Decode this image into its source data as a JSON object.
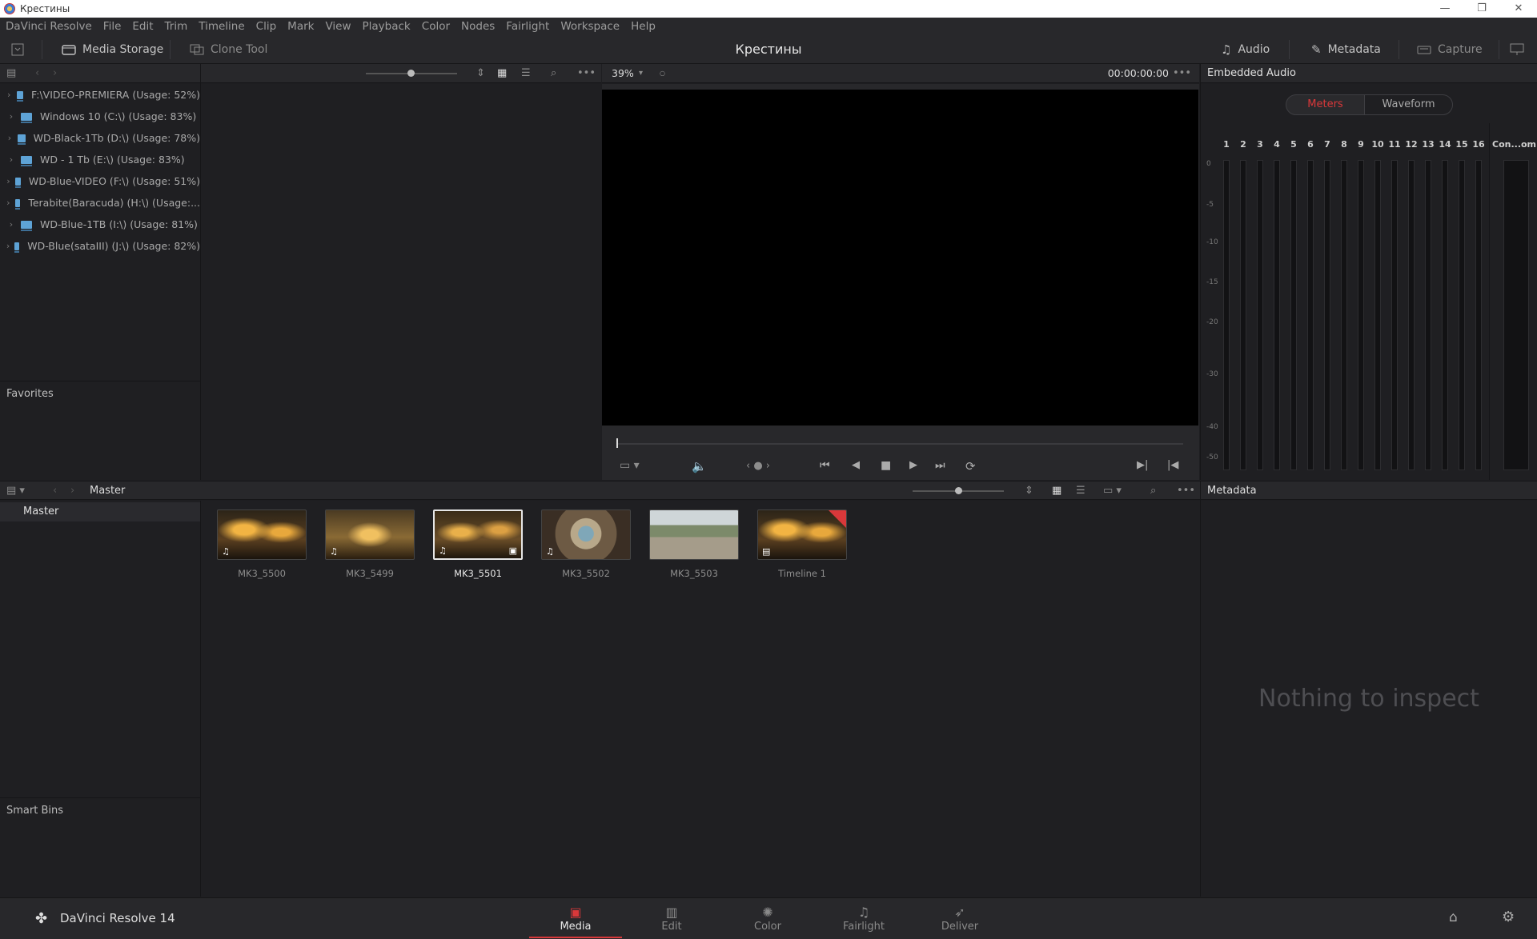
{
  "window": {
    "title": "Крестины",
    "buttons": [
      "—",
      "❐",
      "✕"
    ]
  },
  "menu": [
    "DaVinci Resolve",
    "File",
    "Edit",
    "Trim",
    "Timeline",
    "Clip",
    "Mark",
    "View",
    "Playback",
    "Color",
    "Nodes",
    "Fairlight",
    "Workspace",
    "Help"
  ],
  "toolbar": {
    "media_storage": "Media Storage",
    "clone_tool": "Clone Tool",
    "project_title": "Крестины",
    "audio": "Audio",
    "metadata": "Metadata",
    "capture": "Capture"
  },
  "storage": {
    "drives": [
      "F:\\VIDEO-PREMIERA (Usage: 52%)",
      "Windows 10 (C:\\) (Usage: 83%)",
      "WD-Black-1Tb (D:\\) (Usage: 78%)",
      "WD - 1 Tb (E:\\) (Usage: 83%)",
      "WD-Blue-VIDEO (F:\\) (Usage: 51%)",
      "Terabite(Baracuda) (H:\\) (Usage:...",
      "WD-Blue-1TB (I:\\) (Usage: 81%)",
      "WD-Blue(sataIII) (J:\\) (Usage: 82%)"
    ],
    "favorites": "Favorites"
  },
  "viewer": {
    "zoom": "39%",
    "timecode": "00:00:00:00"
  },
  "audio_panel": {
    "title": "Embedded Audio",
    "tabs": [
      "Meters",
      "Waveform"
    ],
    "active_tab": "Meters",
    "channels": [
      "1",
      "2",
      "3",
      "4",
      "5",
      "6",
      "7",
      "8",
      "9",
      "10",
      "11",
      "12",
      "13",
      "14",
      "15",
      "16"
    ],
    "extra_channel": "Con...om",
    "db_scale": [
      "0",
      "-5",
      "-10",
      "-15",
      "-20",
      "-30",
      "-40",
      "-50"
    ]
  },
  "media_pool": {
    "breadcrumb": "Master",
    "bins": [
      "Master"
    ],
    "smart_bins": "Smart Bins",
    "clips": [
      {
        "name": "MK3_5500",
        "selected": false
      },
      {
        "name": "MK3_5499",
        "selected": false
      },
      {
        "name": "MK3_5501",
        "selected": true
      },
      {
        "name": "MK3_5502",
        "selected": false
      },
      {
        "name": "MK3_5503",
        "selected": false
      },
      {
        "name": "Timeline 1",
        "selected": false
      }
    ]
  },
  "metadata_panel": {
    "title": "Metadata",
    "empty": "Nothing to inspect"
  },
  "pagebar": {
    "app_name": "DaVinci Resolve 14",
    "pages": [
      "Media",
      "Edit",
      "Color",
      "Fairlight",
      "Deliver"
    ],
    "active_page": "Media"
  },
  "colors": {
    "accent": "#d9383a",
    "panel": "#1f1f22",
    "header": "#28282b",
    "drive_icon": "#5ea3d6"
  }
}
